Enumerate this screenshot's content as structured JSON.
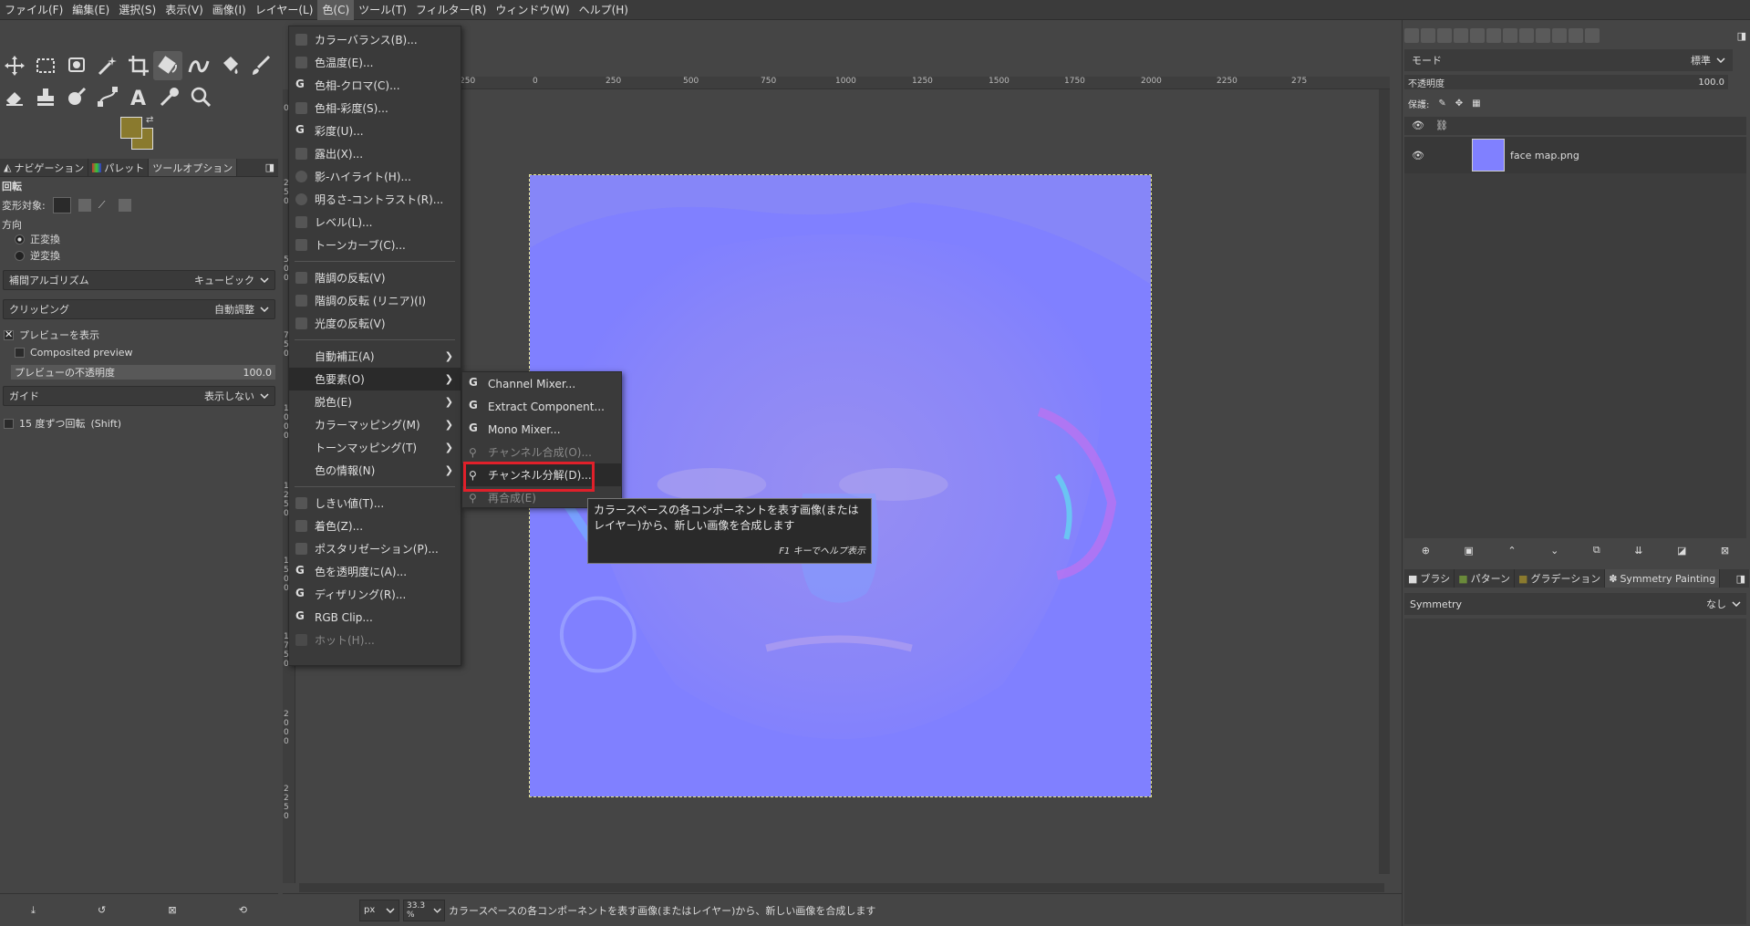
{
  "menubar": {
    "items": [
      "ファイル(F)",
      "編集(E)",
      "選択(S)",
      "表示(V)",
      "画像(I)",
      "レイヤー(L)",
      "色(C)",
      "ツール(T)",
      "フィルター(R)",
      "ウィンドウ(W)",
      "ヘルプ(H)"
    ],
    "active_index": 6
  },
  "left_dock": {
    "tabs": [
      "ナビゲーション",
      "パレット",
      "ツールオプション"
    ],
    "tool_title": "回転",
    "transform_label": "変形対象:",
    "direction_label": "方向",
    "direction_normal": "正変換",
    "direction_reverse": "逆変換",
    "interp_label": "補間アルゴリズム",
    "interp_value": "キュービック",
    "clip_label": "クリッピング",
    "clip_value": "自動調整",
    "show_preview": "プレビューを表示",
    "composited_preview": "Composited preview",
    "preview_opacity_label": "プレビューの不透明度",
    "preview_opacity_value": "100.0",
    "guide_label": "ガイド",
    "guide_value": "表示しない",
    "rotate15": "15 度ずつ回転",
    "rotate15_key": "(Shift)"
  },
  "colors": {
    "fg": "#8a7a2e",
    "bg": "#8a7a2e",
    "image_base": "#8080ff",
    "highlight": "#e0202a"
  },
  "ruler_h_labels": [
    "250",
    "0",
    "250",
    "500",
    "750",
    "1000",
    "1250",
    "1500",
    "1750",
    "2000",
    "2250",
    "275"
  ],
  "ruler_v_labels": [
    "0",
    "2 5 0",
    "5 0 0",
    "7 5 0",
    "1 0 0 0",
    "1 2 5 0",
    "1 5 0 0",
    "1 7 5 0",
    "2 0 0 0",
    "2 2 5 0"
  ],
  "color_menu": {
    "group1": [
      "カラーバランス(B)...",
      "色温度(E)...",
      "色相-クロマ(C)...",
      "色相-彩度(S)...",
      "彩度(U)...",
      "露出(X)...",
      "影-ハイライト(H)...",
      "明るさ-コントラスト(R)...",
      "レベル(L)...",
      "トーンカーブ(C)..."
    ],
    "group2": [
      "階調の反転(V)",
      "階調の反転 (リニア)(I)",
      "光度の反転(V)"
    ],
    "group3": [
      "自動補正(A)",
      "色要素(O)",
      "脱色(E)",
      "カラーマッピング(M)",
      "トーンマッピング(T)",
      "色の情報(N)"
    ],
    "group4": [
      "しきい値(T)...",
      "着色(Z)...",
      "ポスタリゼーション(P)...",
      "色を透明度に(A)...",
      "ディザリング(R)...",
      "RGB Clip...",
      "ホット(H)..."
    ]
  },
  "components_menu": {
    "items": [
      "Channel Mixer...",
      "Extract Component...",
      "Mono Mixer...",
      "チャンネル合成(O)...",
      "チャンネル分解(D)...",
      "再合成(E)"
    ]
  },
  "tooltip": {
    "text": "カラースペースの各コンポーネントを表す画像(またはレイヤー)から、新しい画像を合成します",
    "hint": "F1 キーでヘルプ表示"
  },
  "statusbar": {
    "unit": "px",
    "zoom": "33.3 %",
    "message": "カラースペースの各コンポーネントを表す画像(またはレイヤー)から、新しい画像を合成します"
  },
  "right_dock": {
    "mode_label": "モード",
    "mode_value": "標準",
    "opacity_label": "不透明度",
    "opacity_value": "100.0",
    "lock_label": "保護:",
    "layer_name": "face map.png",
    "tabs": [
      "ブラシ",
      "パターン",
      "グラデーション",
      "Symmetry Painting"
    ],
    "symmetry_label": "Symmetry",
    "symmetry_value": "なし"
  }
}
